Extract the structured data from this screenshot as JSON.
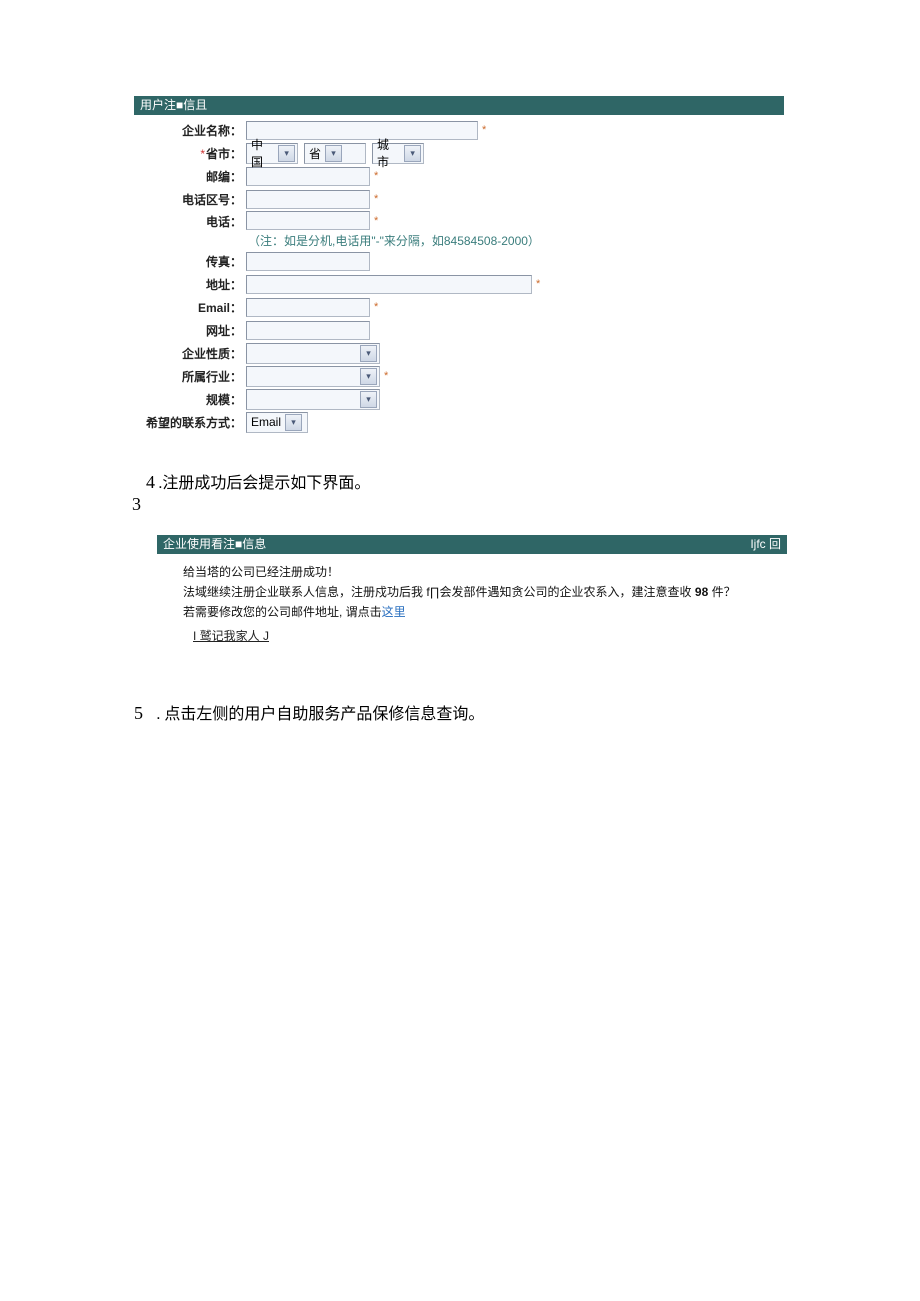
{
  "form": {
    "header": "用户注■信且",
    "labels": {
      "company": "企业名称：",
      "province_city": "省市：",
      "postal": "邮编：",
      "area_code": "电话区号：",
      "phone": "电话：",
      "fax": "传真：",
      "address": "地址：",
      "email": "Email：",
      "website": "网址：",
      "nature": "企业性质：",
      "industry": "所属行业：",
      "scale": "规模：",
      "contact_pref": "希望的联系方式："
    },
    "selects": {
      "country": "中国",
      "province": "省",
      "city": "城市",
      "contact_pref": "Email"
    },
    "phone_note": "（注：如是分机,电话用\"-\"来分隔，如84584508-2000）",
    "required_mark": "*"
  },
  "steps": {
    "s3": "3",
    "s4_num": "4",
    "s4_text": ".注册成功后会提示如下界面。",
    "s5_num": "5",
    "s5_text": ". 点击左侧的用户自助服务产品保修信息查询。"
  },
  "success": {
    "header_left": "企业使用看注■信息",
    "header_right": "Ijfc 回",
    "line1": "给当塔的公司已经注册成功！",
    "line2_a": "法域继续注册企业联系人信息，注册戍功后我 f∏会发部件遇知贪公司的企业农系入，建注意查收 ",
    "line2_b": "98",
    "line2_c": " 件？",
    "line3_a": "若需要修改您的公司邮件地址, 谓点击",
    "line3_link": "这里",
    "reg_contact": "I 鹫记我家人 J"
  }
}
